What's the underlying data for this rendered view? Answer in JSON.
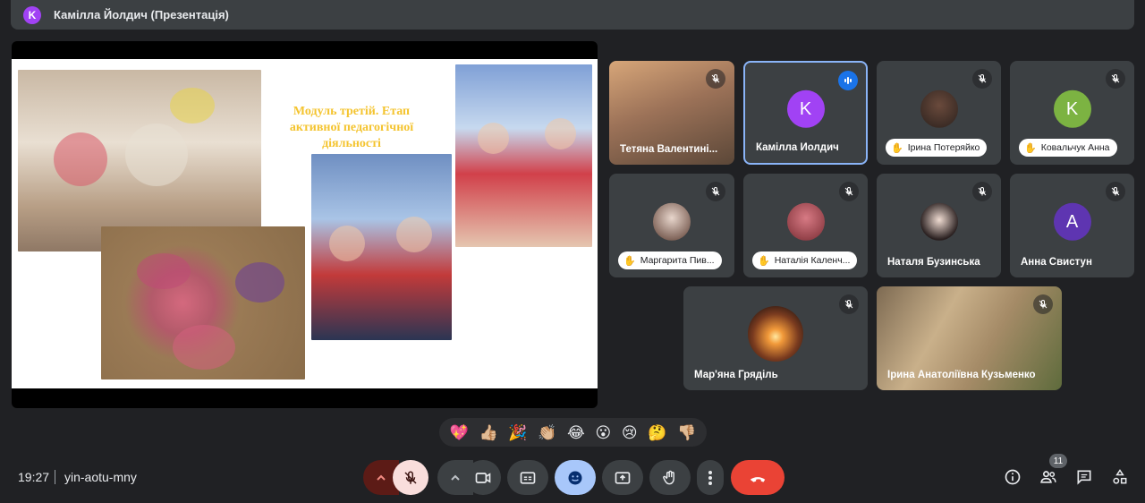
{
  "window": {
    "presenter_initial": "K",
    "presenter_title": "Камілла Йолдич (Презентація)"
  },
  "slide": {
    "title": "Модуль третій. Етап активної педагогічної діяльності"
  },
  "participants": [
    {
      "name": "Тетяна Валентині...",
      "type": "video",
      "muted": true
    },
    {
      "name": "Камілла Йолдич",
      "type": "avatar",
      "initial": "K",
      "color": "#a142f4",
      "speaking": true
    },
    {
      "name": "Ірина Потеряйко",
      "type": "photo",
      "muted": true,
      "hand_raised": true
    },
    {
      "name": "Ковальчук Анна",
      "type": "avatar",
      "initial": "K",
      "color": "#7cb342",
      "muted": true,
      "hand_raised": true
    },
    {
      "name": "Маргарита Пив...",
      "type": "photo",
      "muted": true,
      "hand_raised": true
    },
    {
      "name": "Наталія Каленч...",
      "type": "photo",
      "muted": true,
      "hand_raised": true
    },
    {
      "name": "Наталя Бузинська",
      "type": "photo",
      "muted": true
    },
    {
      "name": "Анна Свистун",
      "type": "avatar",
      "initial": "A",
      "color": "#5e35b1",
      "muted": true
    },
    {
      "name": "Мар'яна Гряділь",
      "type": "photo",
      "muted": true
    },
    {
      "name": "Ірина Анатоліївна Кузьменко",
      "type": "video",
      "muted": true
    }
  ],
  "reactions": [
    "💖",
    "👍🏼",
    "🎉",
    "👏🏼",
    "😂",
    "😮",
    "😢",
    "🤔",
    "👎🏼"
  ],
  "meeting": {
    "time": "19:27",
    "code": "yin-aotu-mny",
    "participant_count": "11"
  },
  "colors": {
    "background": "#202124",
    "tile": "#3c4043",
    "end_call": "#ea4335",
    "mic_muted": "#f9dedc",
    "active_blue": "#a8c7fa"
  }
}
